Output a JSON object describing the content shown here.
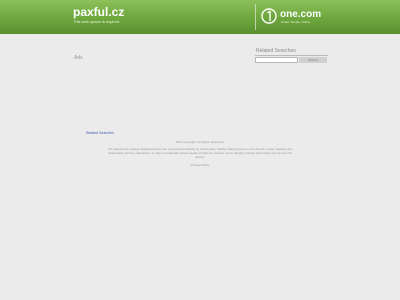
{
  "header": {
    "title": "paxful.cz",
    "subtitle": "This web space is expired."
  },
  "brand": {
    "name": "one.com",
    "tagline": "Smart. Simple. Online.",
    "icon": "one-com-logo-icon"
  },
  "main": {
    "ads_label": "Ads",
    "related_link": "Related Searches"
  },
  "sidebar": {
    "related_title": "Related Searches",
    "search_placeholder": "",
    "search_button": "Search"
  },
  "footer": {
    "copyright": "2013 Copyright. All Rights Reserved.",
    "disclaimer": "The Sponsored Listings displayed above are served automatically by a third party. Neither Parking host nor the domain owner maintain any relationship with the advertisers. In case of trademark issues please contact the domain owner directly (contact information can be found in whois).",
    "privacy": "Privacy Policy"
  },
  "colors": {
    "header_green": "#6da63d",
    "page_background": "#ebebeb",
    "link_blue": "#4060b0"
  }
}
